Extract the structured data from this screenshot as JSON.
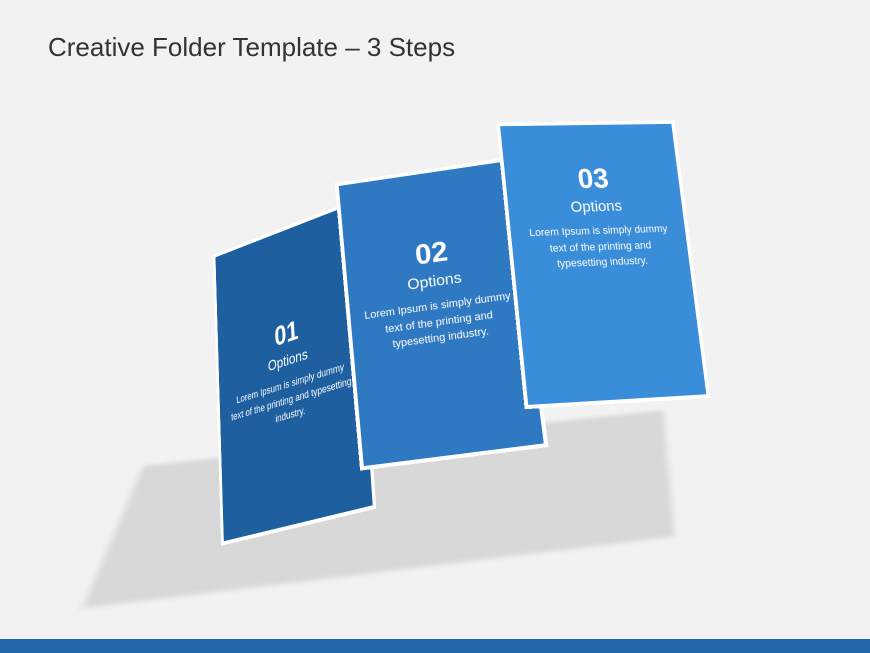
{
  "title": "Creative Folder Template – 3 Steps",
  "panels": [
    {
      "number": "01",
      "label": "Options",
      "body": "Lorem Ipsum is simply dummy text of the printing and typesetting industry."
    },
    {
      "number": "02",
      "label": "Options",
      "body": "Lorem Ipsum is simply dummy text of the printing and typesetting industry."
    },
    {
      "number": "03",
      "label": "Options",
      "body": "Lorem Ipsum is simply dummy text of the printing and typesetting industry."
    }
  ],
  "colors": {
    "background": "#f2f2f2",
    "panel1": "#1e5fa0",
    "panel2": "#2e79c1",
    "panel3": "#3a8dd8",
    "footer": "#2166a8"
  }
}
